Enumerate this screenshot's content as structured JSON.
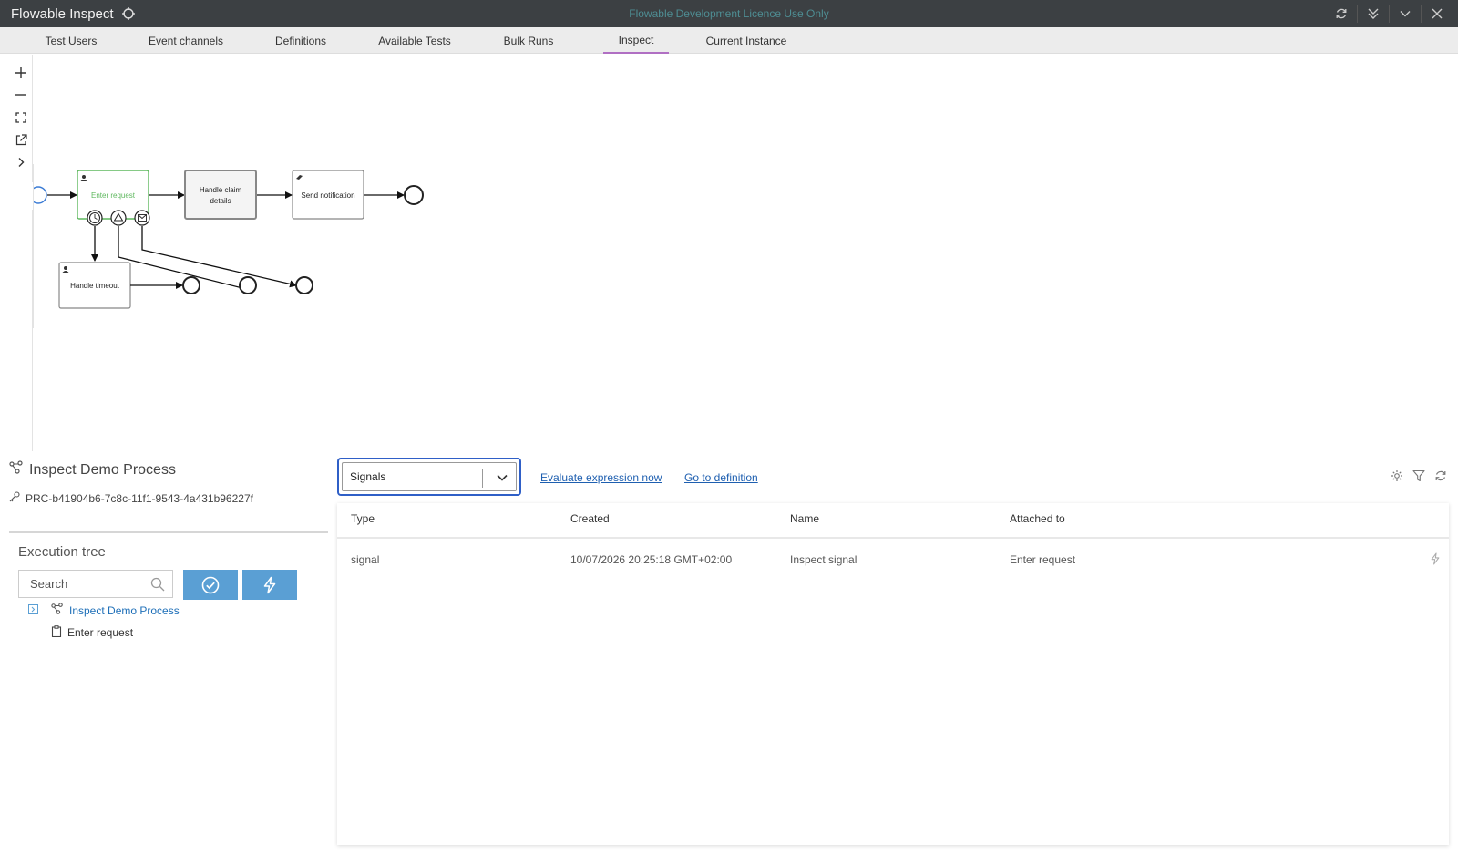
{
  "app": {
    "title": "Flowable Inspect",
    "licence_banner": "Flowable Development Licence Use Only",
    "window_controls": [
      "refresh-icon",
      "double-chevron-down-icon",
      "chevron-down-icon",
      "close-icon"
    ]
  },
  "tabs": [
    {
      "label": "Test Users",
      "active": false
    },
    {
      "label": "Event channels",
      "active": false
    },
    {
      "label": "Definitions",
      "active": false
    },
    {
      "label": "Available Tests",
      "active": false
    },
    {
      "label": "Bulk Runs",
      "active": false
    },
    {
      "label": "Inspect",
      "active": true
    },
    {
      "label": "Current Instance",
      "active": false
    }
  ],
  "diagram": {
    "toolbar": [
      "zoom-in-icon",
      "zoom-out-icon",
      "fit-screen-icon",
      "open-external-icon",
      "expand-icon"
    ],
    "nodes": {
      "enter_request": "Enter request",
      "handle_claim_line1": "Handle claim",
      "handle_claim_line2": "details",
      "send_notification": "Send notification",
      "handle_timeout": "Handle timeout"
    },
    "active_color": "#5fb85f"
  },
  "process": {
    "name": "Inspect Demo Process",
    "id": "PRC-b41904b6-7c8c-11f1-9543-4a431b96227f"
  },
  "execution_tree": {
    "title": "Execution tree",
    "search_placeholder": "Search",
    "items": [
      {
        "label": "Inspect Demo Process",
        "icon": "process-icon"
      },
      {
        "label": "Enter request",
        "icon": "clipboard-icon"
      }
    ]
  },
  "inspector": {
    "selected": "Signals",
    "links": {
      "evaluate": "Evaluate expression now",
      "goto": "Go to definition"
    },
    "columns": [
      "Type",
      "Created",
      "Name",
      "Attached to"
    ],
    "rows": [
      {
        "type": "signal",
        "created": "10/07/2026 20:25:18 GMT+02:00",
        "name": "Inspect signal",
        "attached_to": "Enter request"
      }
    ]
  },
  "colors": {
    "accent": "#5a9fd4",
    "tab_active": "#b06fc3",
    "link": "#1e5fb0"
  }
}
